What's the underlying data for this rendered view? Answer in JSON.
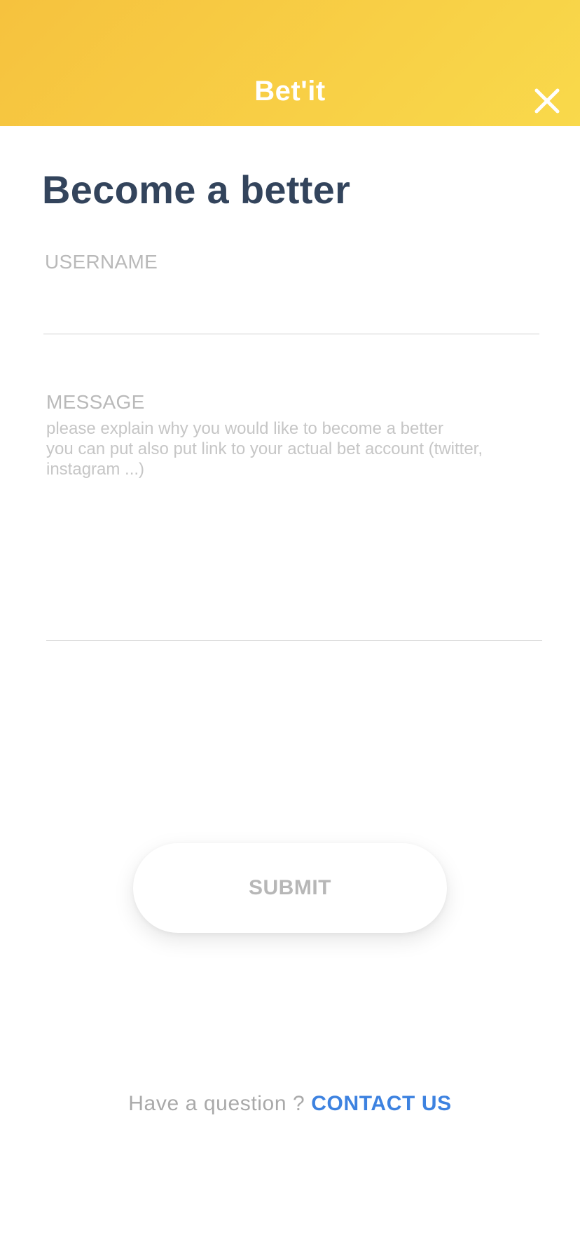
{
  "header": {
    "app_title": "Bet'it",
    "close_icon": "close-icon",
    "gradient_colors": [
      "#f6c23e",
      "#f9d94b"
    ]
  },
  "form": {
    "title": "Become a better",
    "username": {
      "label": "USERNAME",
      "value": ""
    },
    "message": {
      "label": "MESSAGE",
      "value": "",
      "placeholder": "please explain why you would like to become a better\nyou can put also put link to your actual bet account (twitter, instagram ...)"
    },
    "submit_label": "SUBMIT"
  },
  "footer": {
    "question": "Have a question ?",
    "contact_label": "CONTACT US"
  },
  "colors": {
    "title": "#33445c",
    "link": "#3d82e0",
    "muted": "#b9b9b9"
  }
}
